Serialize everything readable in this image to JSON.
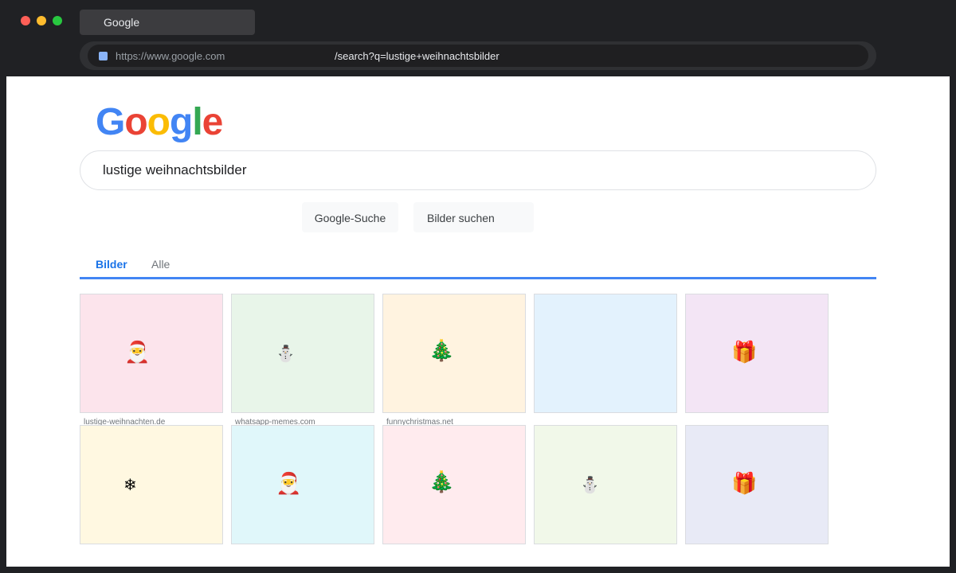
{
  "browser": {
    "tab_title": "Google",
    "url_host": "https://www.google.com",
    "url_path": "/search?q=lustige+weihnachtsbilder"
  },
  "logo": [
    "G",
    "o",
    "o",
    "g",
    "l",
    "e"
  ],
  "search": {
    "query": "lustige weihnachtsbilder"
  },
  "buttons": {
    "search": "Google-Suche",
    "images": "Bilder suchen"
  },
  "tabs": {
    "images": "Bilder",
    "all": "Alle"
  },
  "results": {
    "row1": [
      {
        "icon": "🎅",
        "source": "lustige-weihnachten.de"
      },
      {
        "icon": "⛄",
        "source": "whatsapp-memes.com"
      },
      {
        "icon": "🎄",
        "source": "funnychristmas.net"
      },
      {
        "icon": "",
        "source": ""
      },
      {
        "icon": "🎁",
        "source": ""
      }
    ],
    "row2": [
      {
        "icon": "❄"
      },
      {
        "icon": "🎅"
      },
      {
        "icon": "🎄"
      },
      {
        "icon": "⛄"
      },
      {
        "icon": "🎁"
      }
    ]
  },
  "colors": {
    "logo": [
      "#4285f4",
      "#ea4335",
      "#fbbc05",
      "#4285f4",
      "#34a853",
      "#ea4335"
    ],
    "tiles_row1": [
      "#fce4ec",
      "#e8f5e9",
      "#fff3e0",
      "#e3f2fd",
      "#f3e5f5"
    ],
    "tiles_row2": [
      "#fff8e1",
      "#e0f7fa",
      "#ffebee",
      "#f1f8e9",
      "#e8eaf6"
    ]
  }
}
